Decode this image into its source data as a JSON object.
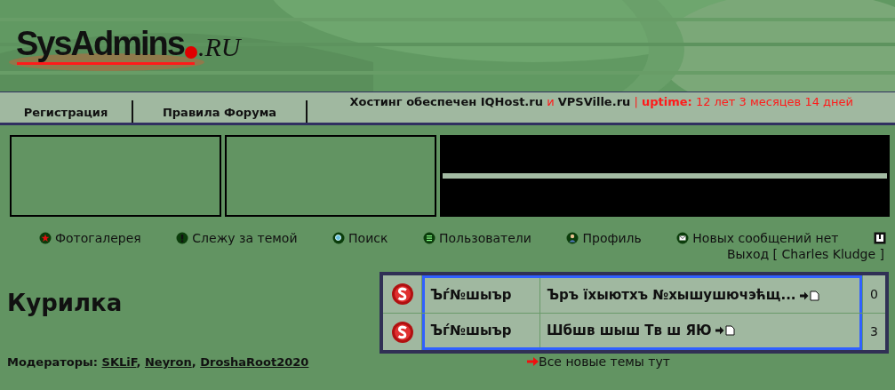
{
  "logo": {
    "name": "SysAdmins",
    "suffix": ".RU"
  },
  "tabs": [
    {
      "label": "Регистрация"
    },
    {
      "label": "Правила Форума"
    }
  ],
  "hosting": {
    "prefix": "Хостинг обеспечен",
    "host1": "IQHost.ru",
    "and": "и",
    "host2": "VPSVille.ru",
    "separator": "|",
    "uptime_label": "uptime:",
    "uptime": "12 лет 3 месяцев 14 дней"
  },
  "nav": [
    {
      "label": "Фотогалерея",
      "kind": "star"
    },
    {
      "label": "Слежу за темой",
      "kind": "exclaim"
    },
    {
      "label": "Поиск",
      "kind": "search"
    },
    {
      "label": "Пользователи",
      "kind": "list"
    },
    {
      "label": "Профиль",
      "kind": "person"
    },
    {
      "label": "Новых сообщений нет",
      "kind": "mail"
    },
    {
      "label": "Выход [ Charles Kludge ]",
      "kind": "exit"
    }
  ],
  "forum_title": "Курилка",
  "topics": [
    {
      "author": "Ъѓ№шыър",
      "title": "Ъръ їхыютхъ №хышушючэћщ...",
      "count": "0"
    },
    {
      "author": "Ъѓ№шыър",
      "title": "Шбшв шыш Тв ш ЯЮ",
      "count": "3"
    }
  ],
  "new_topics_link": "Все новые темы тут",
  "moderators": {
    "label": "Модераторы:",
    "separator": ",",
    "names": [
      "SKLiF",
      "Neyron",
      "DroshaRoot2020"
    ]
  }
}
